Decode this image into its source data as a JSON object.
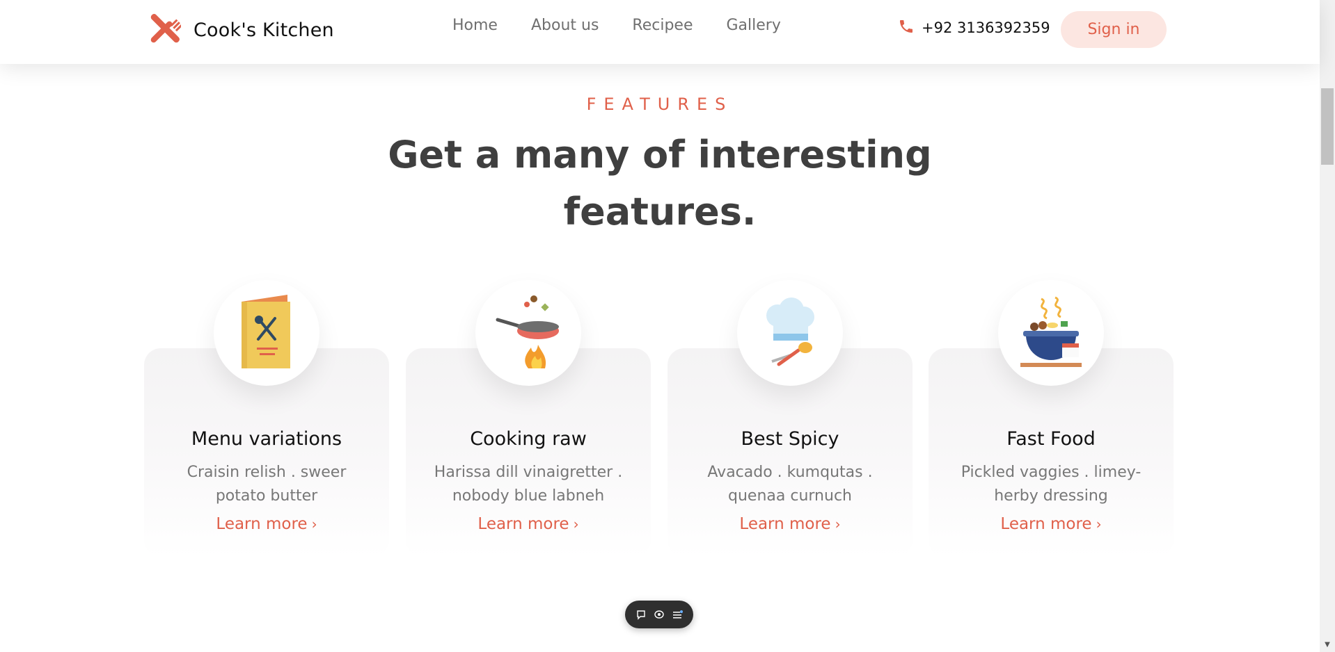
{
  "header": {
    "brand": "Cook's Kitchen",
    "brand_color": "#e0604a",
    "nav": [
      {
        "label": "Home"
      },
      {
        "label": "About us"
      },
      {
        "label": "Recipee"
      },
      {
        "label": "Gallery"
      }
    ],
    "phone": "+92 3136392359",
    "signin_label": "Sign in"
  },
  "section": {
    "eyebrow": "FEATURES",
    "headline_line1": "Get a many of interesting",
    "headline_line2": "features."
  },
  "cards": [
    {
      "icon": "menu-card-icon",
      "title": "Menu variations",
      "desc": "Craisin relish . sweer potato butter",
      "link": "Learn more"
    },
    {
      "icon": "frying-pan-icon",
      "title": "Cooking raw",
      "desc": "Harissa dill vinaigretter . nobody blue labneh",
      "link": "Learn more"
    },
    {
      "icon": "chef-hat-icon",
      "title": "Best Spicy",
      "desc": "Avacado . kumqutas . quenaa curnuch",
      "link": "Learn more"
    },
    {
      "icon": "noodle-bowl-icon",
      "title": "Fast Food",
      "desc": "Pickled vaggies . limey-herby dressing",
      "link": "Learn more"
    }
  ],
  "toolbar": {
    "items": [
      "chat-bubble-icon",
      "screen-icon",
      "list-icon"
    ]
  }
}
